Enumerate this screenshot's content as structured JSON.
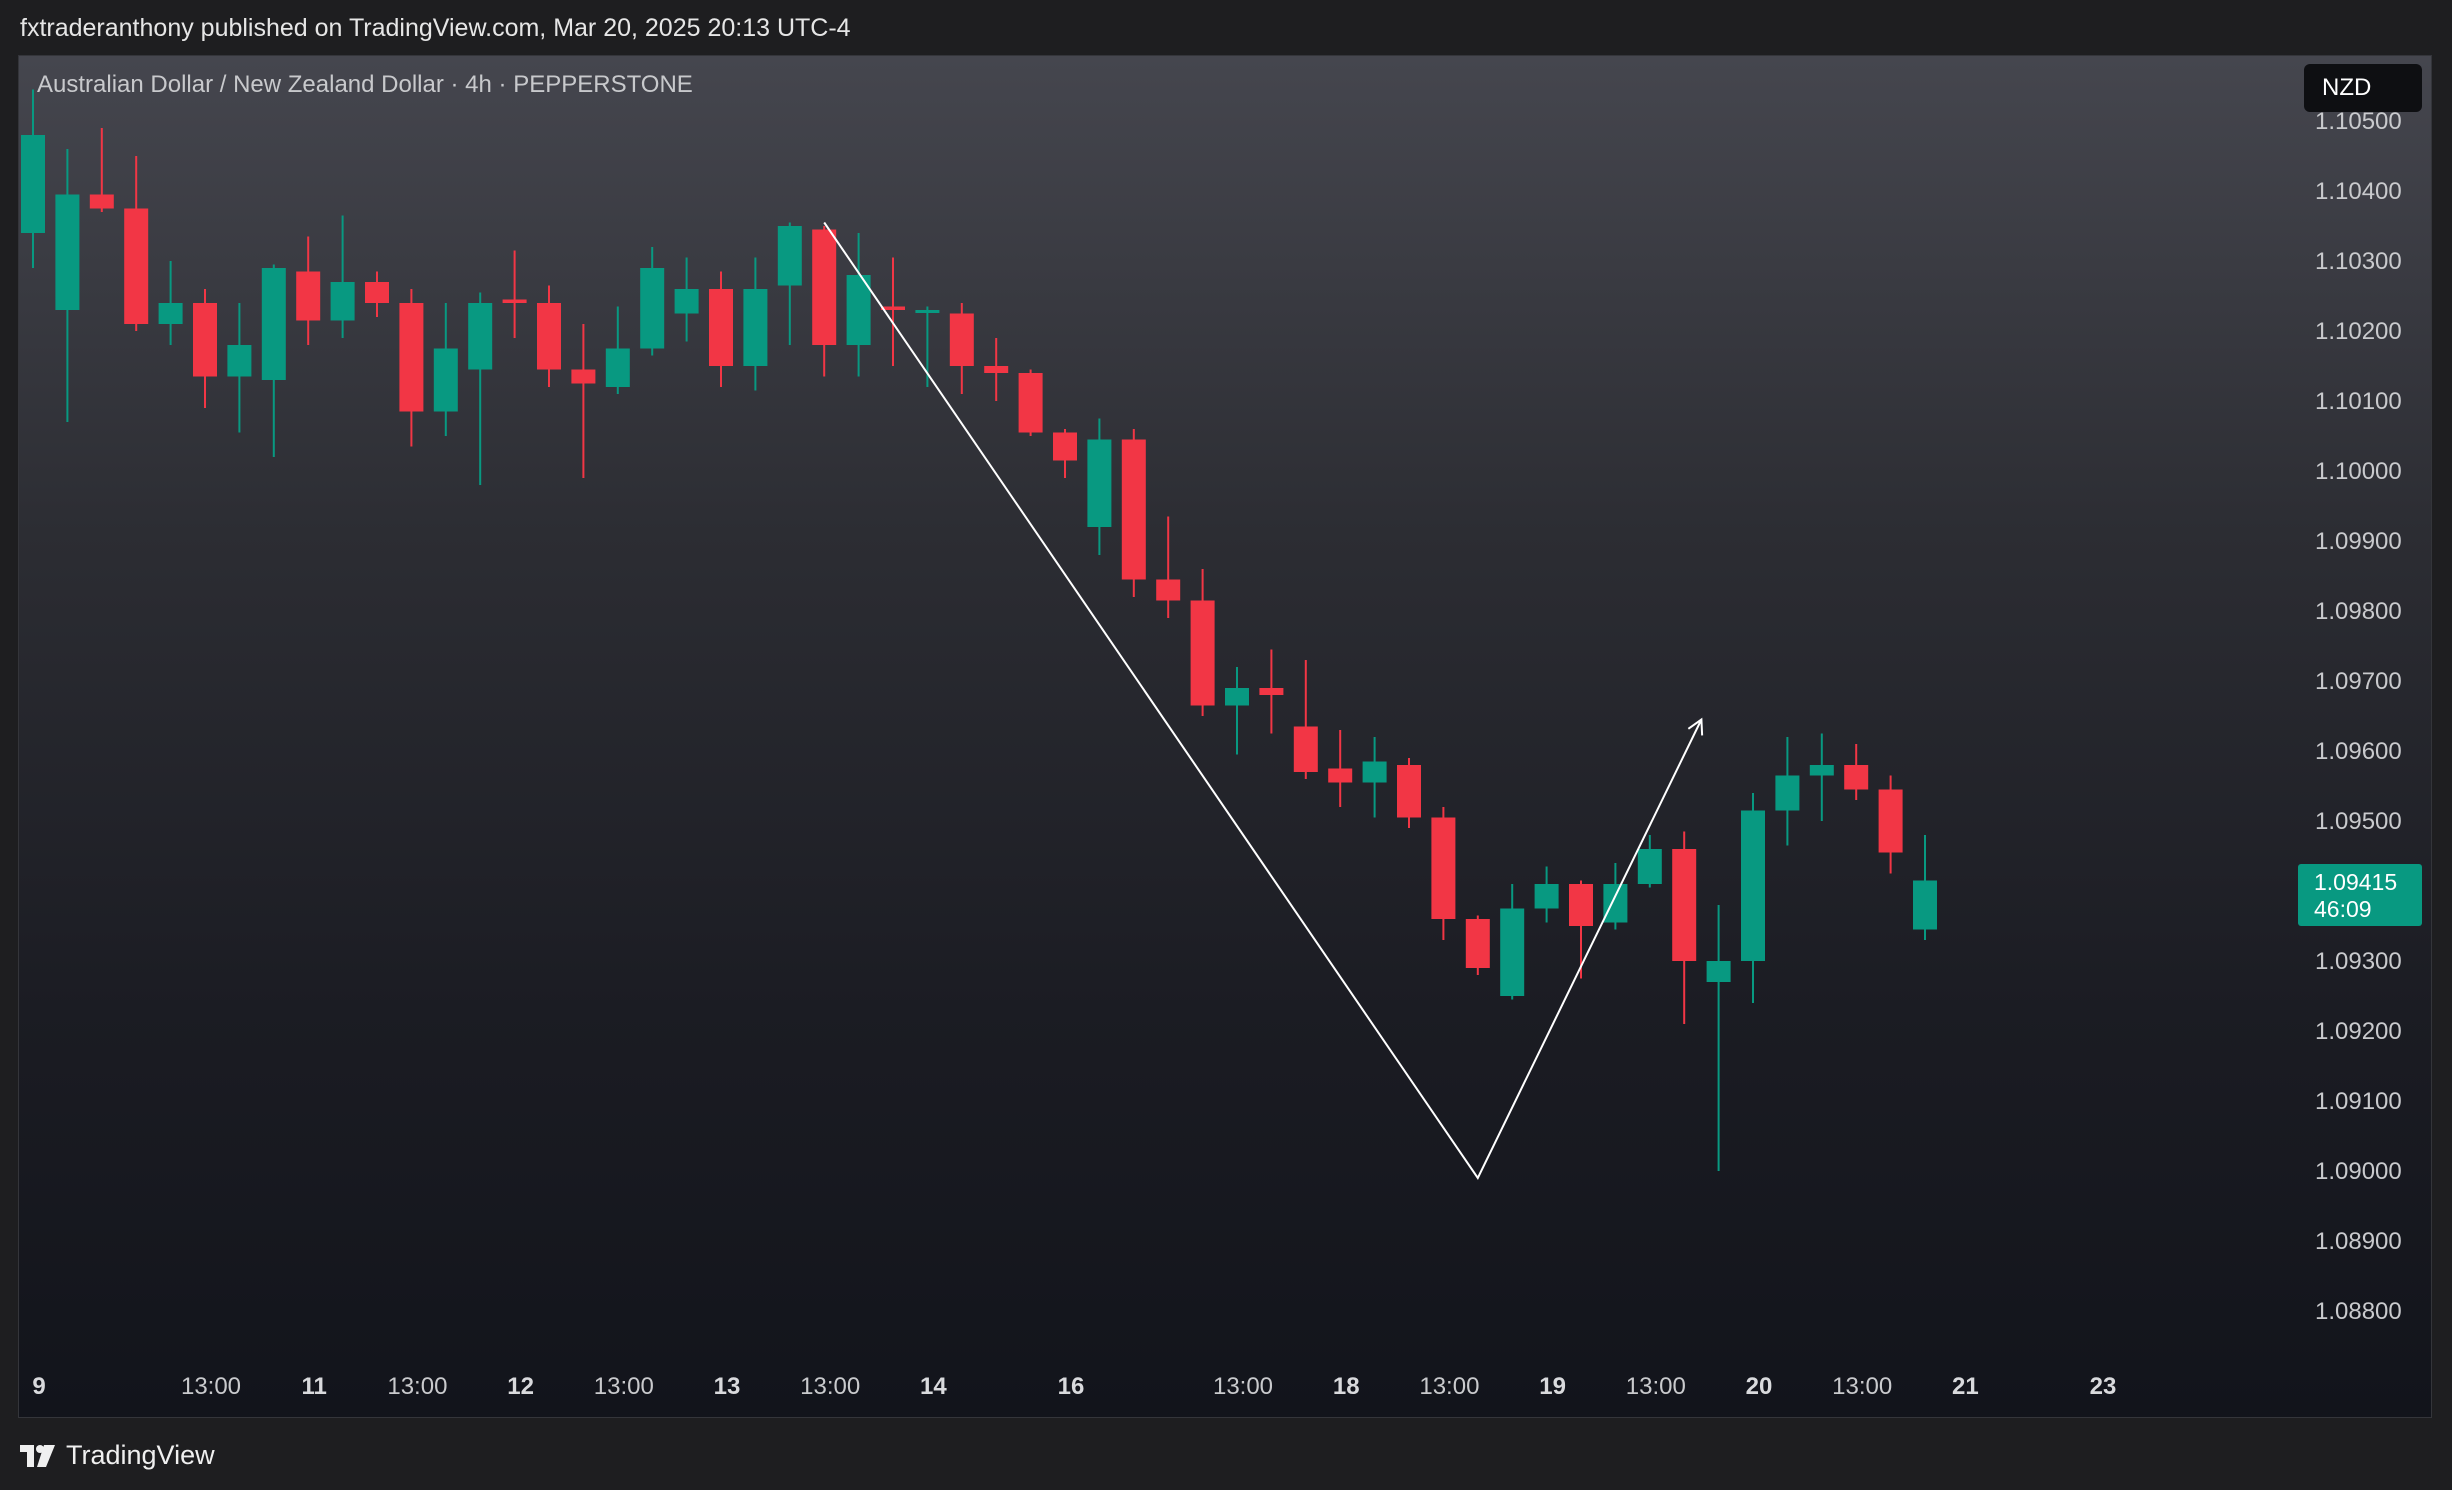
{
  "header": {
    "publish_text": "fxtraderanthony published on TradingView.com, Mar 20, 2025 20:13 UTC-4"
  },
  "chart_header": {
    "symbol_label": "Australian Dollar / New Zealand Dollar · 4h · PEPPERSTONE",
    "currency_badge": "NZD"
  },
  "price_tag": {
    "price": "1.09415",
    "countdown": "46:09"
  },
  "footer": {
    "logo_text": "TradingView",
    "logo_icon": "tradingview-logo-icon"
  },
  "colors": {
    "up": "#089981",
    "down": "#f23645",
    "drawing": "#ffffff"
  },
  "chart_data": {
    "type": "candlestick",
    "title": "",
    "ylim": [
      1.0873,
      1.1065
    ],
    "y_ticks": [
      "1.10500",
      "1.10400",
      "1.10300",
      "1.10200",
      "1.10100",
      "1.10000",
      "1.09900",
      "1.09800",
      "1.09700",
      "1.09600",
      "1.09500",
      "1.09400",
      "1.09300",
      "1.09200",
      "1.09100",
      "1.09000",
      "1.08900",
      "1.08800"
    ],
    "x_ticks": [
      {
        "label": "9",
        "index": 0,
        "bold": true
      },
      {
        "label": "13:00",
        "index": 5,
        "bold": false
      },
      {
        "label": "11",
        "index": 8,
        "bold": true
      },
      {
        "label": "13:00",
        "index": 11,
        "bold": false
      },
      {
        "label": "12",
        "index": 14,
        "bold": true
      },
      {
        "label": "13:00",
        "index": 17,
        "bold": false
      },
      {
        "label": "13",
        "index": 20,
        "bold": true
      },
      {
        "label": "13:00",
        "index": 23,
        "bold": false
      },
      {
        "label": "14",
        "index": 26,
        "bold": true
      },
      {
        "label": "16",
        "index": 30,
        "bold": true
      },
      {
        "label": "13:00",
        "index": 35,
        "bold": false
      },
      {
        "label": "18",
        "index": 38,
        "bold": true
      },
      {
        "label": "13:00",
        "index": 41,
        "bold": false
      },
      {
        "label": "19",
        "index": 44,
        "bold": true
      },
      {
        "label": "13:00",
        "index": 47,
        "bold": false
      },
      {
        "label": "20",
        "index": 50,
        "bold": true
      },
      {
        "label": "13:00",
        "index": 53,
        "bold": false
      },
      {
        "label": "21",
        "index": 56,
        "bold": true
      },
      {
        "label": "23",
        "index": 60,
        "bold": true
      }
    ],
    "candles": [
      {
        "o": 1.1034,
        "h": 1.10545,
        "l": 1.1029,
        "c": 1.1048
      },
      {
        "o": 1.1023,
        "h": 1.1046,
        "l": 1.1007,
        "c": 1.10395
      },
      {
        "o": 1.10395,
        "h": 1.1049,
        "l": 1.1037,
        "c": 1.10375
      },
      {
        "o": 1.10375,
        "h": 1.1045,
        "l": 1.102,
        "c": 1.1021
      },
      {
        "o": 1.1021,
        "h": 1.103,
        "l": 1.1018,
        "c": 1.1024
      },
      {
        "o": 1.1024,
        "h": 1.1026,
        "l": 1.1009,
        "c": 1.10135
      },
      {
        "o": 1.10135,
        "h": 1.1024,
        "l": 1.10055,
        "c": 1.1018
      },
      {
        "o": 1.1013,
        "h": 1.10295,
        "l": 1.1002,
        "c": 1.1029
      },
      {
        "o": 1.10285,
        "h": 1.10335,
        "l": 1.1018,
        "c": 1.10215
      },
      {
        "o": 1.10215,
        "h": 1.10365,
        "l": 1.1019,
        "c": 1.1027
      },
      {
        "o": 1.1027,
        "h": 1.10285,
        "l": 1.1022,
        "c": 1.1024
      },
      {
        "o": 1.1024,
        "h": 1.1026,
        "l": 1.10035,
        "c": 1.10085
      },
      {
        "o": 1.10085,
        "h": 1.1024,
        "l": 1.1005,
        "c": 1.10175
      },
      {
        "o": 1.10145,
        "h": 1.10255,
        "l": 1.0998,
        "c": 1.1024
      },
      {
        "o": 1.10245,
        "h": 1.10315,
        "l": 1.1019,
        "c": 1.1024
      },
      {
        "o": 1.1024,
        "h": 1.10265,
        "l": 1.1012,
        "c": 1.10145
      },
      {
        "o": 1.10145,
        "h": 1.1021,
        "l": 1.0999,
        "c": 1.10125
      },
      {
        "o": 1.1012,
        "h": 1.10235,
        "l": 1.1011,
        "c": 1.10175
      },
      {
        "o": 1.10175,
        "h": 1.1032,
        "l": 1.10165,
        "c": 1.1029
      },
      {
        "o": 1.10225,
        "h": 1.10305,
        "l": 1.10185,
        "c": 1.1026
      },
      {
        "o": 1.1026,
        "h": 1.10285,
        "l": 1.1012,
        "c": 1.1015
      },
      {
        "o": 1.1015,
        "h": 1.10305,
        "l": 1.10115,
        "c": 1.1026
      },
      {
        "o": 1.10265,
        "h": 1.10355,
        "l": 1.1018,
        "c": 1.1035
      },
      {
        "o": 1.10345,
        "h": 1.1035,
        "l": 1.10135,
        "c": 1.1018
      },
      {
        "o": 1.1018,
        "h": 1.1034,
        "l": 1.10135,
        "c": 1.1028
      },
      {
        "o": 1.10235,
        "h": 1.10305,
        "l": 1.1015,
        "c": 1.1023
      },
      {
        "o": 1.1023,
        "h": 1.10235,
        "l": 1.1012,
        "c": 1.1023
      },
      {
        "o": 1.10225,
        "h": 1.1024,
        "l": 1.1011,
        "c": 1.1015
      },
      {
        "o": 1.1015,
        "h": 1.1019,
        "l": 1.101,
        "c": 1.1014
      },
      {
        "o": 1.1014,
        "h": 1.10145,
        "l": 1.1005,
        "c": 1.10055
      },
      {
        "o": 1.10055,
        "h": 1.1006,
        "l": 1.0999,
        "c": 1.10015
      },
      {
        "o": 1.0992,
        "h": 1.10075,
        "l": 1.0988,
        "c": 1.10045
      },
      {
        "o": 1.10045,
        "h": 1.1006,
        "l": 1.0982,
        "c": 1.09845
      },
      {
        "o": 1.09845,
        "h": 1.09935,
        "l": 1.0979,
        "c": 1.09815
      },
      {
        "o": 1.09815,
        "h": 1.0986,
        "l": 1.0965,
        "c": 1.09665
      },
      {
        "o": 1.09665,
        "h": 1.0972,
        "l": 1.09595,
        "c": 1.0969
      },
      {
        "o": 1.0969,
        "h": 1.09745,
        "l": 1.09625,
        "c": 1.0968
      },
      {
        "o": 1.09635,
        "h": 1.0973,
        "l": 1.0956,
        "c": 1.0957
      },
      {
        "o": 1.09575,
        "h": 1.0963,
        "l": 1.0952,
        "c": 1.09555
      },
      {
        "o": 1.09555,
        "h": 1.0962,
        "l": 1.09505,
        "c": 1.09585
      },
      {
        "o": 1.0958,
        "h": 1.0959,
        "l": 1.0949,
        "c": 1.09505
      },
      {
        "o": 1.09505,
        "h": 1.0952,
        "l": 1.0933,
        "c": 1.0936
      },
      {
        "o": 1.0936,
        "h": 1.09365,
        "l": 1.0928,
        "c": 1.0929
      },
      {
        "o": 1.0925,
        "h": 1.0941,
        "l": 1.09245,
        "c": 1.09375
      },
      {
        "o": 1.09375,
        "h": 1.09435,
        "l": 1.09355,
        "c": 1.0941
      },
      {
        "o": 1.0941,
        "h": 1.09415,
        "l": 1.09275,
        "c": 1.0935
      },
      {
        "o": 1.09355,
        "h": 1.0944,
        "l": 1.09345,
        "c": 1.0941
      },
      {
        "o": 1.0941,
        "h": 1.0948,
        "l": 1.09405,
        "c": 1.0946
      },
      {
        "o": 1.0946,
        "h": 1.09485,
        "l": 1.0921,
        "c": 1.093
      },
      {
        "o": 1.0927,
        "h": 1.0938,
        "l": 1.09,
        "c": 1.093
      },
      {
        "o": 1.093,
        "h": 1.0954,
        "l": 1.0924,
        "c": 1.09515
      },
      {
        "o": 1.09515,
        "h": 1.0962,
        "l": 1.09465,
        "c": 1.09565
      },
      {
        "o": 1.09565,
        "h": 1.09625,
        "l": 1.095,
        "c": 1.0958
      },
      {
        "o": 1.0958,
        "h": 1.0961,
        "l": 1.0953,
        "c": 1.09545
      },
      {
        "o": 1.09545,
        "h": 1.09565,
        "l": 1.09425,
        "c": 1.09455
      },
      {
        "o": 1.09345,
        "h": 1.0948,
        "l": 1.0933,
        "c": 1.09415
      }
    ],
    "drawing": {
      "type": "arrow-path",
      "points": [
        {
          "index": 23,
          "price": 1.10355
        },
        {
          "index": 42,
          "price": 1.0899
        },
        {
          "index": 48.5,
          "price": 1.09645
        }
      ]
    },
    "last_price": 1.09415
  }
}
